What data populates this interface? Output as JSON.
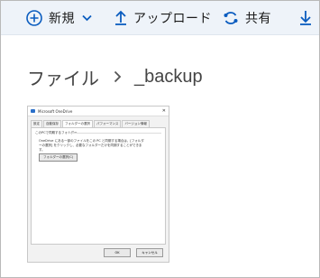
{
  "toolbar": {
    "new_label": "新規",
    "upload_label": "アップロード",
    "share_label": "共有"
  },
  "breadcrumb": {
    "root": "ファイル",
    "current": "_backup"
  },
  "thumbnail": {
    "window_title": "Microsoft OneDrive",
    "close_glyph": "✕",
    "tabs": [
      "設定",
      "自動保存",
      "フォルダーの選択",
      "パフォーマンス",
      "バージョン情報"
    ],
    "section_label": "このPCで同期するフォルダー",
    "body_text": "OneDrive にある一部のファイルをこの PC と同期する場合は、[フォルダーの選択] をクリックし、必要なフォルダーだけを同期することができます。",
    "choose_button": "フォルダーの選択(C)",
    "ok_button": "OK",
    "cancel_button": "キャンセル"
  },
  "colors": {
    "accent": "#0a5cbf",
    "toolbar_bg": "#eef3f9"
  }
}
